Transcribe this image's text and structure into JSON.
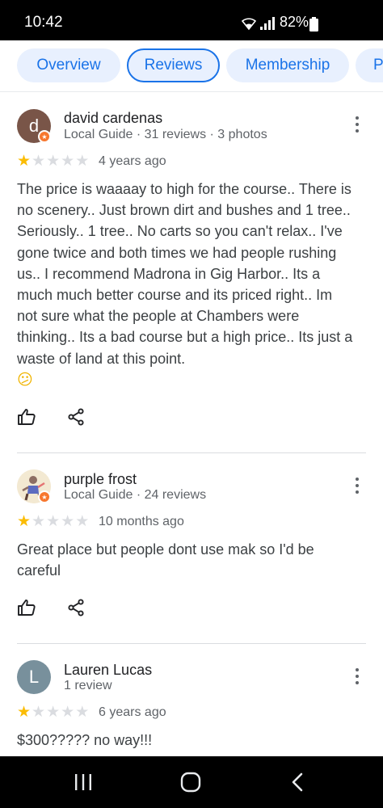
{
  "status_bar": {
    "time": "10:42",
    "battery": "82%",
    "icons": [
      "wifi-icon",
      "signal-icon",
      "battery-icon"
    ]
  },
  "tabs": [
    {
      "label": "Overview",
      "active": false
    },
    {
      "label": "Reviews",
      "active": true
    },
    {
      "label": "Membership",
      "active": false
    },
    {
      "label": "P",
      "active": false
    }
  ],
  "reviews": [
    {
      "avatar_letter": "d",
      "avatar_color": "#795548",
      "name": "david cardenas",
      "meta": "Local Guide · 31 reviews · 3 photos",
      "rating": 1,
      "time": "4 years ago",
      "text": "The price is waaaay to high for the course.. There is no scenery.. Just brown dirt and bushes and 1 tree.. Seriously.. 1 tree.. No carts so you can't relax.. I've gone twice and both times we had people rushing us.. I recommend Madrona in Gig Harbor.. Its a much much better course and its priced right.. Im not sure what the people at Chambers were thinking.. Its a bad course but a high price.. Its just a waste of land at this point.",
      "emoji": "😕",
      "local_guide": true
    },
    {
      "avatar_letter": "",
      "avatar_color": "#f3e9d2",
      "name": "purple frost",
      "meta": "Local Guide · 24 reviews",
      "rating": 1,
      "time": "10 months ago",
      "text": "Great place but people dont use mak so I'd be careful",
      "local_guide": true
    },
    {
      "avatar_letter": "L",
      "avatar_color": "#78909c",
      "name": "Lauren Lucas",
      "meta": "1 review",
      "rating": 1,
      "time": "6 years ago",
      "text": "$300????? no way!!!",
      "local_guide": false
    }
  ],
  "nav_bar": {
    "buttons": [
      "recent-apps-icon",
      "home-icon",
      "back-icon"
    ]
  },
  "colors": {
    "accent": "#1a73e8",
    "tab_bg": "#e8f0fe",
    "star_on": "#fbbc04",
    "star_off": "#dadce0",
    "local_guide_badge": "#f7772e"
  }
}
